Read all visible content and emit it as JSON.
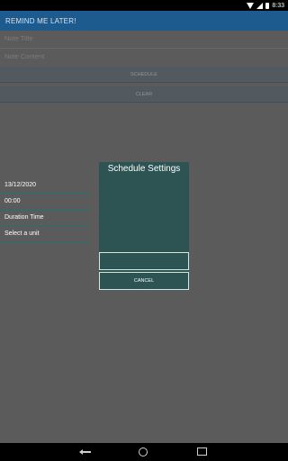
{
  "status_bar": {
    "time": "8:33",
    "icons": [
      "wifi-icon",
      "signal-icon",
      "battery-icon"
    ]
  },
  "app": {
    "title": "REMIND ME LATER!"
  },
  "form": {
    "title_placeholder": "Note Title",
    "content_placeholder": "Note Content",
    "schedule_label": "SCHEDULE",
    "clear_label": "CLEAR"
  },
  "dialog": {
    "title": "Schedule Settings",
    "date": "13/12/2020",
    "time": "00:00",
    "duration_label": "Duration Time",
    "unit_label": "Select a unit",
    "ok_label": "",
    "cancel_label": "CANCEL"
  },
  "nav_bar": {
    "icons": [
      "back-icon",
      "home-icon",
      "recent-apps-icon"
    ]
  },
  "colors": {
    "app_bar": "#1d5b8e",
    "dialog_bg": "#2e5353",
    "scrim": "#5b5b5b"
  }
}
